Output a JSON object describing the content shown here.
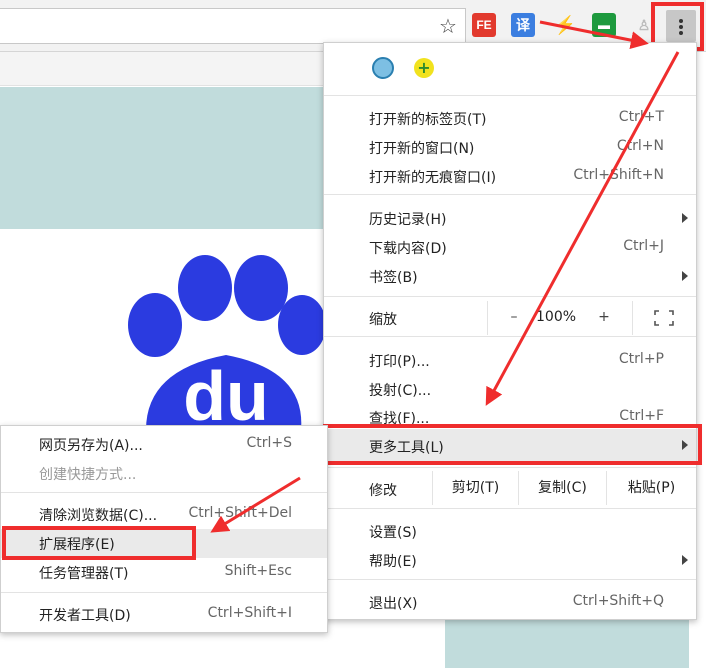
{
  "toolbar": {
    "ext_fe": "FE",
    "ext_translate": "译",
    "ext_lightning": "⚡",
    "ext_toolbox": "▬",
    "ext_person": "♙",
    "star": "☆"
  },
  "main_menu": {
    "items": [
      {
        "label": "打开新的标签页(T)",
        "shortcut": "Ctrl+T"
      },
      {
        "label": "打开新的窗口(N)",
        "shortcut": "Ctrl+N"
      },
      {
        "label": "打开新的无痕窗口(I)",
        "shortcut": "Ctrl+Shift+N"
      },
      {
        "label": "历史记录(H)",
        "shortcut": ""
      },
      {
        "label": "下载内容(D)",
        "shortcut": "Ctrl+J"
      },
      {
        "label": "书签(B)",
        "shortcut": ""
      },
      {
        "label": "打印(P)...",
        "shortcut": "Ctrl+P"
      },
      {
        "label": "投射(C)...",
        "shortcut": ""
      },
      {
        "label": "查找(F)...",
        "shortcut": "Ctrl+F"
      },
      {
        "label": "更多工具(L)",
        "shortcut": ""
      },
      {
        "label": "设置(S)",
        "shortcut": ""
      },
      {
        "label": "帮助(E)",
        "shortcut": ""
      },
      {
        "label": "退出(X)",
        "shortcut": "Ctrl+Shift+Q"
      }
    ],
    "zoom": {
      "label": "缩放",
      "minus": "–",
      "value": "100%",
      "plus": "+"
    },
    "edit": {
      "label": "修改",
      "cut": "剪切(T)",
      "copy": "复制(C)",
      "paste": "粘贴(P)"
    }
  },
  "sub_menu": {
    "items": [
      {
        "label": "网页另存为(A)...",
        "shortcut": "Ctrl+S"
      },
      {
        "label": "创建快捷方式...",
        "shortcut": ""
      },
      {
        "label": "清除浏览数据(C)...",
        "shortcut": "Ctrl+Shift+Del"
      },
      {
        "label": "扩展程序(E)",
        "shortcut": ""
      },
      {
        "label": "任务管理器(T)",
        "shortcut": "Shift+Esc"
      },
      {
        "label": "开发者工具(D)",
        "shortcut": "Ctrl+Shift+I"
      }
    ]
  },
  "baidu_logo": {
    "text": "du"
  },
  "colors": {
    "highlight_red": "#ef2d2d",
    "baidu_blue": "#2b3be0",
    "hero_teal": "#c1dcdc"
  }
}
